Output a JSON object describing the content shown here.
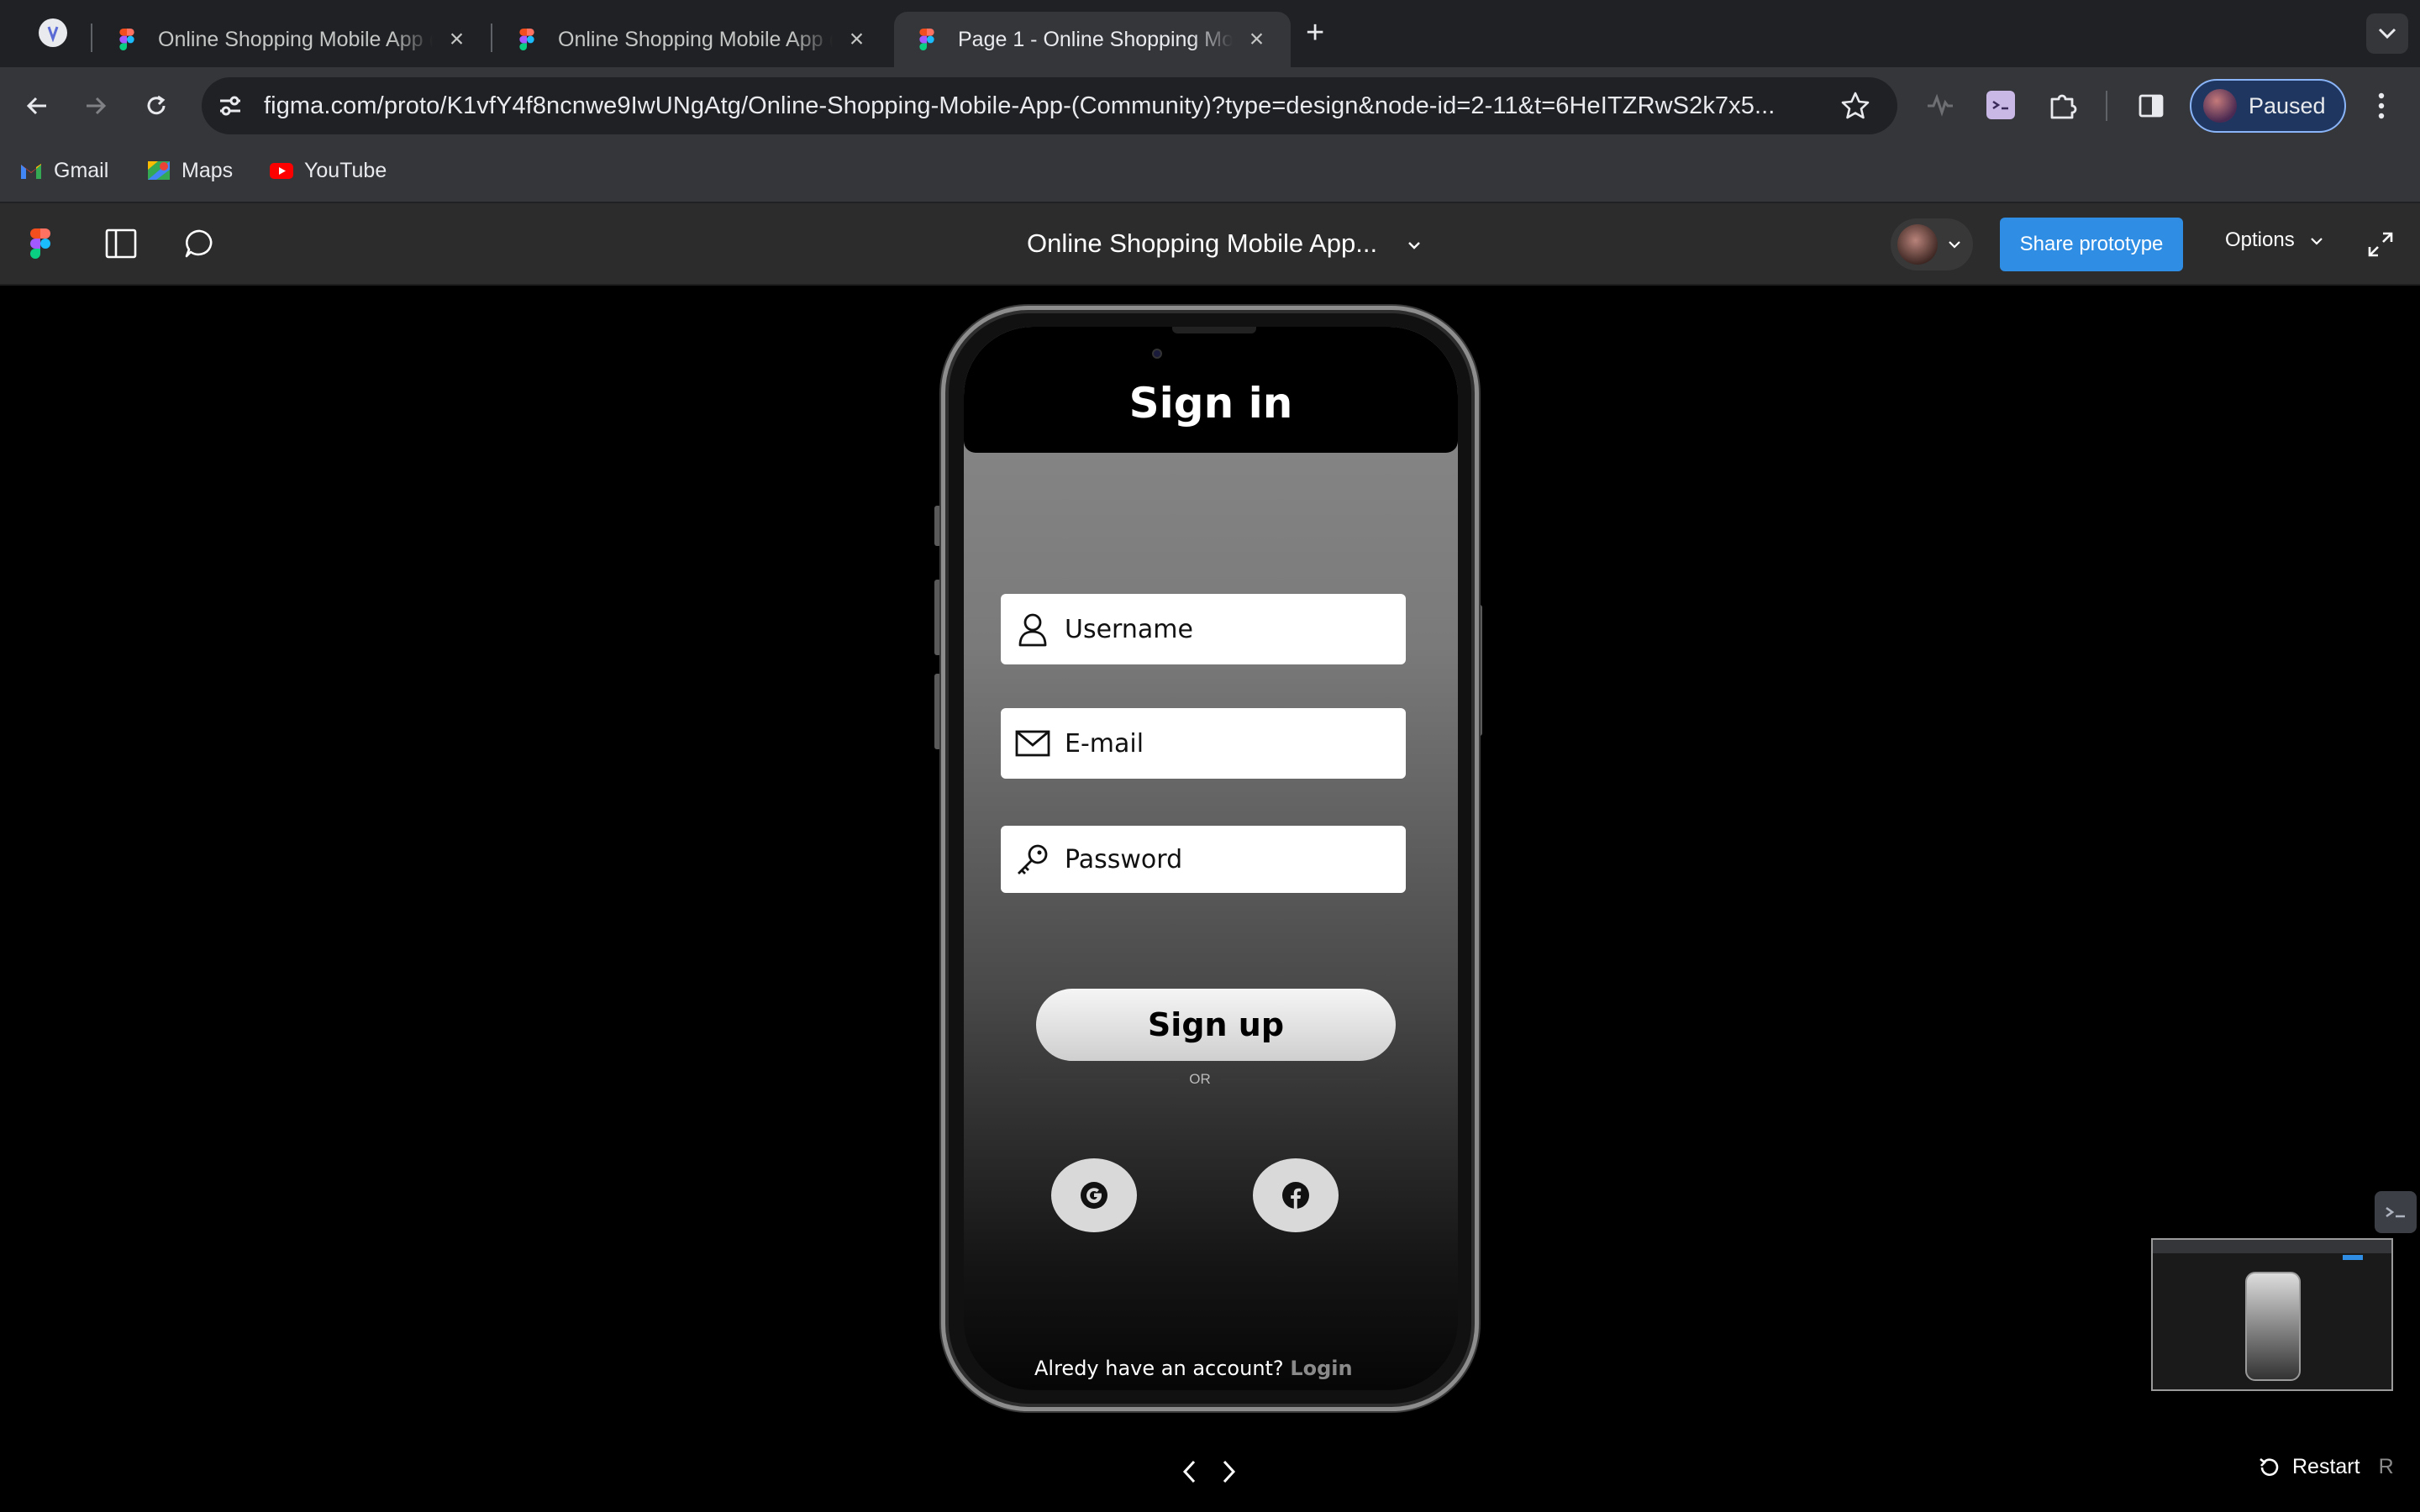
{
  "browser": {
    "tabs": [
      {
        "title": "Online Shopping Mobile App (",
        "active": false
      },
      {
        "title": "Online Shopping Mobile App (",
        "active": false
      },
      {
        "title": "Page 1 - Online Shopping Mob",
        "active": true
      }
    ],
    "new_tab_symbol": "+",
    "url": "figma.com/proto/K1vfY4f8ncnwe9IwUNgAtg/Online-Shopping-Mobile-App-(Community)?type=design&node-id=2-11&t=6HeITZRwS2k7x5...",
    "profile_status": "Paused",
    "bookmarks": [
      {
        "label": "Gmail",
        "icon": "gmail-icon"
      },
      {
        "label": "Maps",
        "icon": "maps-icon"
      },
      {
        "label": "YouTube",
        "icon": "youtube-icon"
      }
    ]
  },
  "figma": {
    "file_title": "Online Shopping Mobile App...",
    "share_label": "Share prototype",
    "options_label": "Options",
    "accent": "#2f8de4"
  },
  "app": {
    "title": "Sign in",
    "fields": [
      {
        "placeholder": "Username",
        "icon": "user-icon"
      },
      {
        "placeholder": "E-mail",
        "icon": "mail-icon"
      },
      {
        "placeholder": "Password",
        "icon": "key-icon"
      }
    ],
    "signup_label": "Sign up",
    "divider_text": "OR",
    "social": [
      "google-icon",
      "facebook-icon"
    ],
    "account_prompt": "Alredy have an account?",
    "login_link": "Login"
  },
  "player": {
    "restart_label": "Restart",
    "restart_key": "R"
  }
}
